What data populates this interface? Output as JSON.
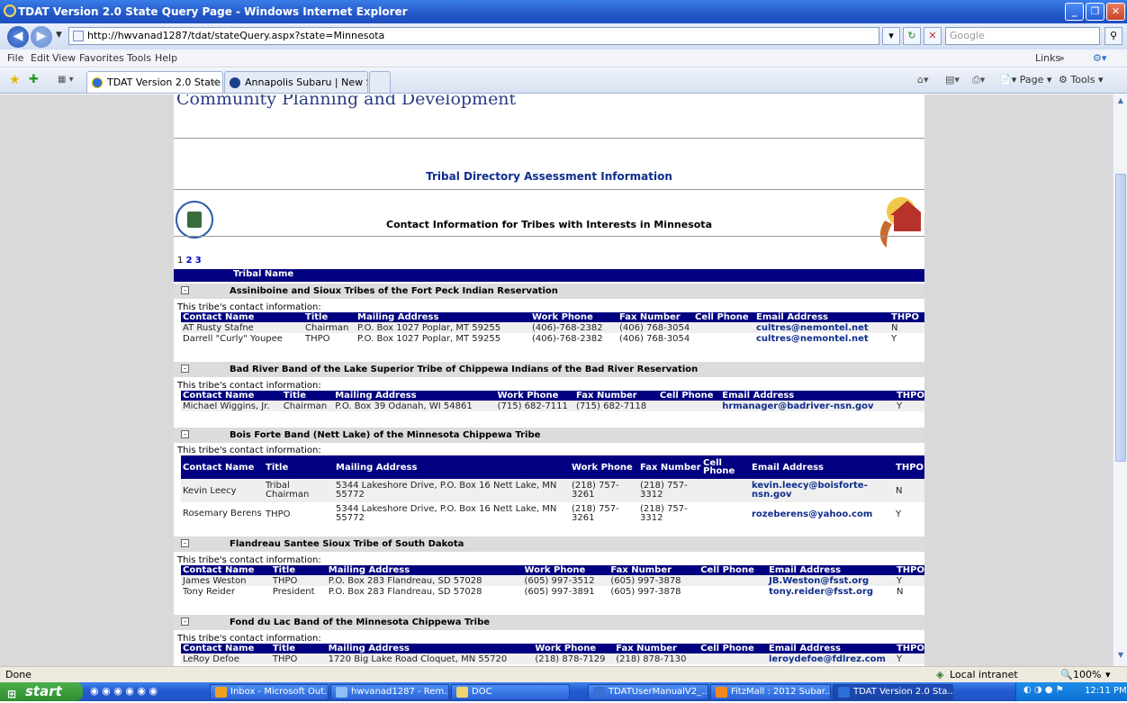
{
  "window": {
    "title": "TDAT Version 2.0 State Query Page - Windows Internet Explorer"
  },
  "address": {
    "url": "http://hwvanad1287/tdat/stateQuery.aspx?state=Minnesota",
    "search_placeholder": "Google"
  },
  "menu": {
    "items": [
      "File",
      "Edit",
      "View",
      "Favorites",
      "Tools",
      "Help"
    ],
    "links": "Links"
  },
  "tabs": [
    {
      "label": "TDAT Version 2.0 State Q..."
    },
    {
      "label": "Annapolis Subaru | New Sub..."
    }
  ],
  "commandbar": {
    "page": "Page",
    "tools": "Tools"
  },
  "page": {
    "header_text": "Community Planning and Development",
    "section_title": "Tribal Directory Assessment Information",
    "subtitle": "Contact Information for Tribes with Interests in Minnesota",
    "pager": {
      "current": "1",
      "pages": [
        "2",
        "3"
      ]
    },
    "tribal_name_header": "Tribal Name",
    "contact_info_label": "This tribe's contact information:",
    "columns": [
      "Contact Name",
      "Title",
      "Mailing Address",
      "Work Phone",
      "Fax Number",
      "Cell Phone",
      "Email Address",
      "THPO"
    ],
    "tribes": [
      {
        "name": "Assiniboine and Sioux Tribes of the Fort Peck Indian Reservation",
        "contacts": [
          {
            "name": "AT Rusty Stafne",
            "title": "Chairman",
            "address": "P.O. Box 1027 Poplar, MT 59255",
            "work": "(406)-768-2382",
            "fax": "(406) 768-3054",
            "cell": "",
            "email": "cultres@nemontel.net",
            "thpo": "N"
          },
          {
            "name": "Darrell \"Curly\" Youpee",
            "title": "THPO",
            "address": "P.O. Box 1027 Poplar, MT 59255",
            "work": "(406)-768-2382",
            "fax": "(406) 768-3054",
            "cell": "",
            "email": "cultres@nemontel.net",
            "thpo": "Y"
          }
        ]
      },
      {
        "name": "Bad River Band of the Lake Superior Tribe of Chippewa Indians of the Bad River Reservation",
        "contacts": [
          {
            "name": "Michael Wiggins, Jr.",
            "title": "Chairman",
            "address": "P.O. Box 39 Odanah, WI 54861",
            "work": "(715) 682-7111",
            "fax": "(715) 682-7118",
            "cell": "",
            "email": "hrmanager@badriver-nsn.gov",
            "thpo": "Y"
          }
        ]
      },
      {
        "name": "Bois Forte Band (Nett Lake) of the Minnesota Chippewa Tribe",
        "contacts": [
          {
            "name": "Kevin Leecy",
            "title": "Tribal Chairman",
            "address": "5344 Lakeshore Drive, P.O. Box 16 Nett Lake, MN 55772",
            "work": "(218) 757-3261",
            "fax": "(218) 757-3312",
            "cell": "",
            "email": "kevin.leecy@boisforte-nsn.gov",
            "thpo": "N"
          },
          {
            "name": "Rosemary Berens",
            "title": "THPO",
            "address": "5344 Lakeshore Drive, P.O. Box 16 Nett Lake, MN 55772",
            "work": "(218) 757-3261",
            "fax": "(218) 757-3312",
            "cell": "",
            "email": "rozeberens@yahoo.com",
            "thpo": "Y"
          }
        ]
      },
      {
        "name": "Flandreau Santee Sioux Tribe of South Dakota",
        "contacts": [
          {
            "name": "James Weston",
            "title": "THPO",
            "address": "P.O. Box 283 Flandreau, SD 57028",
            "work": "(605) 997-3512",
            "fax": "(605) 997-3878",
            "cell": "",
            "email": "JB.Weston@fsst.org",
            "thpo": "Y"
          },
          {
            "name": "Tony Reider",
            "title": "President",
            "address": "P.O. Box 283 Flandreau, SD 57028",
            "work": "(605) 997-3891",
            "fax": "(605) 997-3878",
            "cell": "",
            "email": "tony.reider@fsst.org",
            "thpo": "N"
          }
        ]
      },
      {
        "name": "Fond du Lac Band of the Minnesota Chippewa Tribe",
        "contacts": [
          {
            "name": "LeRoy Defoe",
            "title": "THPO",
            "address": "1720 Big Lake Road Cloquet, MN 55720",
            "work": "(218) 878-7129",
            "fax": "(218) 878-7130",
            "cell": "",
            "email": "leroydefoe@fdlrez.com",
            "thpo": "Y"
          }
        ]
      }
    ]
  },
  "status": {
    "text": "Done",
    "zone": "Local intranet",
    "zoom": "100%"
  },
  "taskbar": {
    "start": "start",
    "items": [
      "Inbox - Microsoft Out...",
      "hwvanad1287 - Rem...",
      "DOC",
      "TDATUserManualV2_...",
      "FitzMall : 2012 Subar...",
      "TDAT Version 2.0 Sta..."
    ],
    "clock": "12:11 PM"
  },
  "colors": {
    "navy": "#000080",
    "tribe_band": "#dcdcdc",
    "title_blue": "#0e2d8c"
  }
}
